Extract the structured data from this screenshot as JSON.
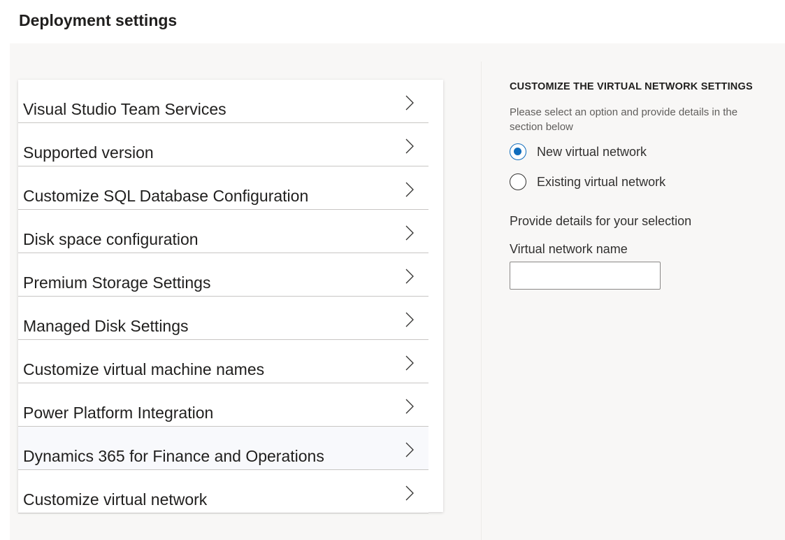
{
  "page": {
    "title": "Deployment settings"
  },
  "settings_list": {
    "items": [
      {
        "label": "Visual Studio Team Services"
      },
      {
        "label": "Supported version"
      },
      {
        "label": "Customize SQL Database Configuration"
      },
      {
        "label": "Disk space configuration"
      },
      {
        "label": "Premium Storage Settings"
      },
      {
        "label": "Managed Disk Settings"
      },
      {
        "label": "Customize virtual machine names"
      },
      {
        "label": "Power Platform Integration"
      },
      {
        "label": "Dynamics 365 for Finance and Operations"
      },
      {
        "label": "Customize virtual network"
      }
    ],
    "chevron_icon": "chevron-right-icon"
  },
  "panel": {
    "heading": "CUSTOMIZE THE VIRTUAL NETWORK SETTINGS",
    "description": "Please select an option and provide details in the section below",
    "options": [
      {
        "label": "New virtual network",
        "checked": true
      },
      {
        "label": "Existing virtual network",
        "checked": false
      }
    ],
    "details_label": "Provide details for your selection",
    "field_label": "Virtual network name",
    "field_value": "",
    "accent_color": "#0f6cbd"
  }
}
